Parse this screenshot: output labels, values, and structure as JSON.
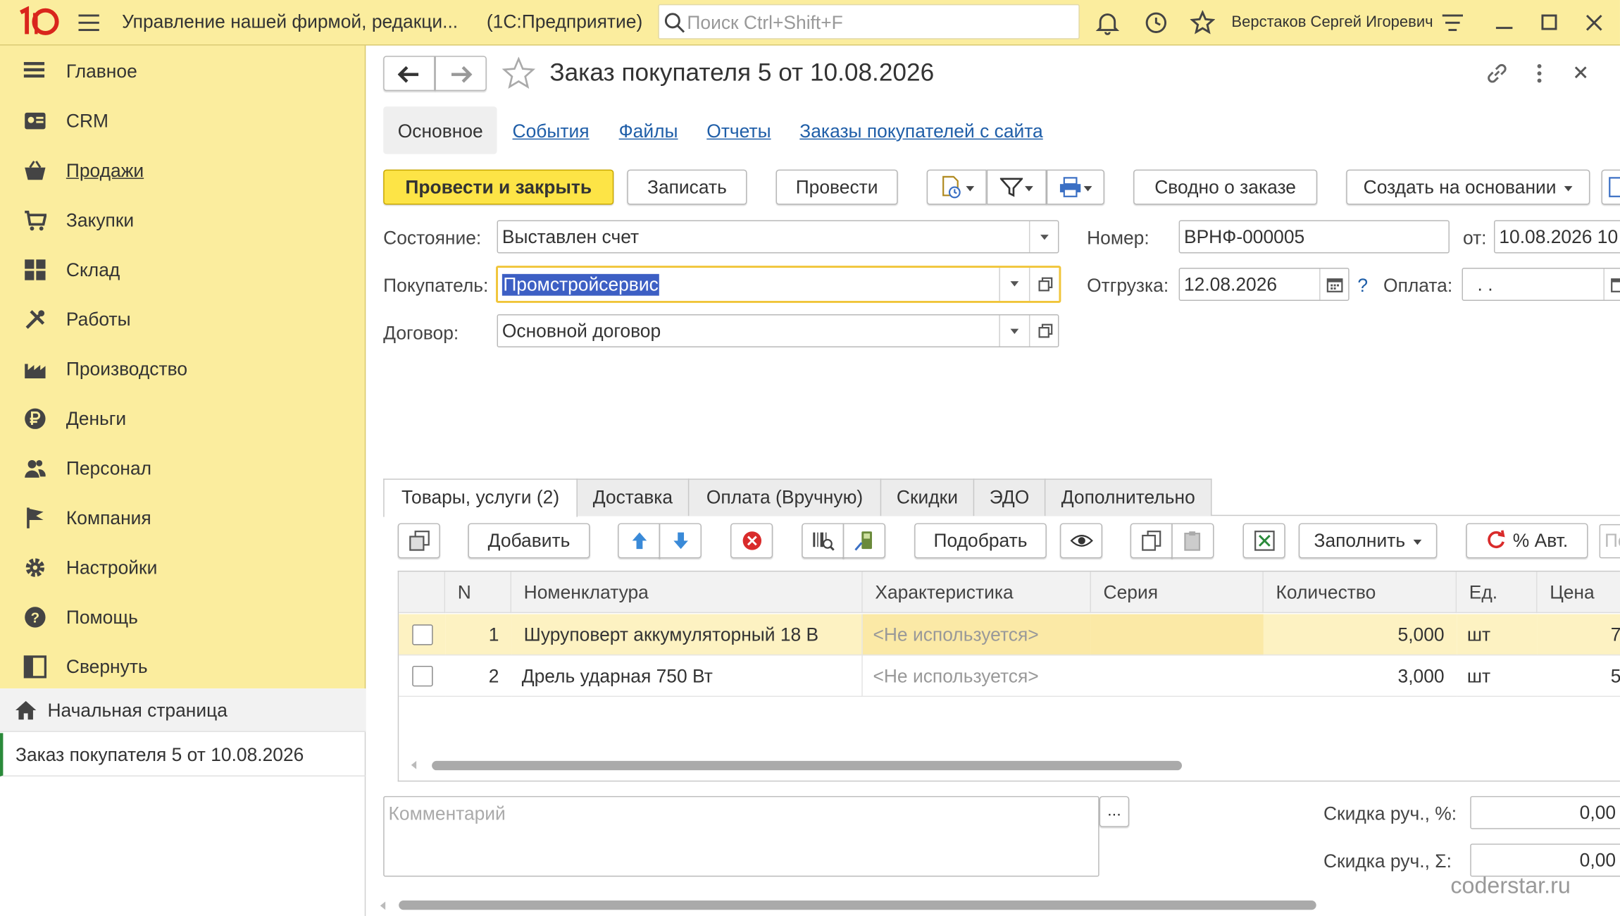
{
  "topbar": {
    "logo": "1С",
    "app_title": "Управление нашей фирмой, редакци...",
    "platform": "(1С:Предприятие)",
    "search_placeholder": "Поиск Ctrl+Shift+F",
    "user": "Верстаков Сергей Игоревич"
  },
  "sidebar": {
    "items": [
      {
        "label": "Главное",
        "icon": "menu-icon"
      },
      {
        "label": "CRM",
        "icon": "crm-icon"
      },
      {
        "label": "Продажи",
        "icon": "basket-icon"
      },
      {
        "label": "Закупки",
        "icon": "cart-icon"
      },
      {
        "label": "Склад",
        "icon": "warehouse-icon"
      },
      {
        "label": "Работы",
        "icon": "tools-icon"
      },
      {
        "label": "Производство",
        "icon": "factory-icon"
      },
      {
        "label": "Деньги",
        "icon": "ruble-icon"
      },
      {
        "label": "Персонал",
        "icon": "people-icon"
      },
      {
        "label": "Компания",
        "icon": "flag-icon"
      },
      {
        "label": "Настройки",
        "icon": "gear-icon"
      },
      {
        "label": "Помощь",
        "icon": "help-icon"
      },
      {
        "label": "Свернуть",
        "icon": "collapse-icon"
      }
    ]
  },
  "open_windows": {
    "home": "Начальная страница",
    "current": "Заказ покупателя 5 от 10.08.2026"
  },
  "form": {
    "title": "Заказ покупателя 5 от 10.08.2026",
    "nav_tabs": [
      "Основное",
      "События",
      "Файлы",
      "Отчеты",
      "Заказы покупателей с сайта"
    ],
    "toolbar": {
      "post_close": "Провести и закрыть",
      "save": "Записать",
      "post": "Провести",
      "summary": "Сводно о заказе",
      "create_based": "Создать на основании"
    },
    "state_label": "Состояние:",
    "state_value": "Выставлен счет",
    "buyer_label": "Покупатель:",
    "buyer_value": "Промстройсервис",
    "contract_label": "Договор:",
    "contract_value": "Основной договор",
    "number_label": "Номер:",
    "number_value": "ВРНФ-000005",
    "from_label": "от:",
    "from_value": "10.08.2026 10",
    "shipment_label": "Отгрузка:",
    "shipment_value": "12.08.2026",
    "shipment_help": "?",
    "payment_label": "Оплата:",
    "payment_value": ". .",
    "tabs": [
      "Товары, услуги (2)",
      "Доставка",
      "Оплата (Вручную)",
      "Скидки",
      "ЭДО",
      "Дополнительно"
    ],
    "table_toolbar": {
      "add": "Добавить",
      "select": "Подобрать",
      "fill": "Заполнить",
      "auto_pct": "% Авт.",
      "search_ph": "По"
    },
    "columns": [
      "N",
      "Номенклатура",
      "Характеристика",
      "Серия",
      "Количество",
      "Ед.",
      "Цена"
    ],
    "rows": [
      {
        "n": "1",
        "name": "Шуруповерт аккумуляторный 18 В",
        "char": "<Не используется>",
        "series": "",
        "qty": "5,000",
        "unit": "шт",
        "price": "7"
      },
      {
        "n": "2",
        "name": "Дрель ударная 750 Вт",
        "char": "<Не используется>",
        "series": "",
        "qty": "3,000",
        "unit": "шт",
        "price": "5"
      }
    ],
    "comment_placeholder": "Комментарий",
    "comment_btn": "...",
    "discount_pct_label": "Скидка руч., %:",
    "discount_pct_value": "0,00",
    "discount_sum_label": "Скидка руч., Σ:",
    "discount_sum_value": "0,00"
  },
  "watermark": "coderstar.ru",
  "colors": {
    "header_bg": "#fbed9e",
    "accent_yellow": "#fde446",
    "link": "#1f5ea8",
    "logo_red": "#d9251c",
    "selection": "#3d5fc4"
  }
}
